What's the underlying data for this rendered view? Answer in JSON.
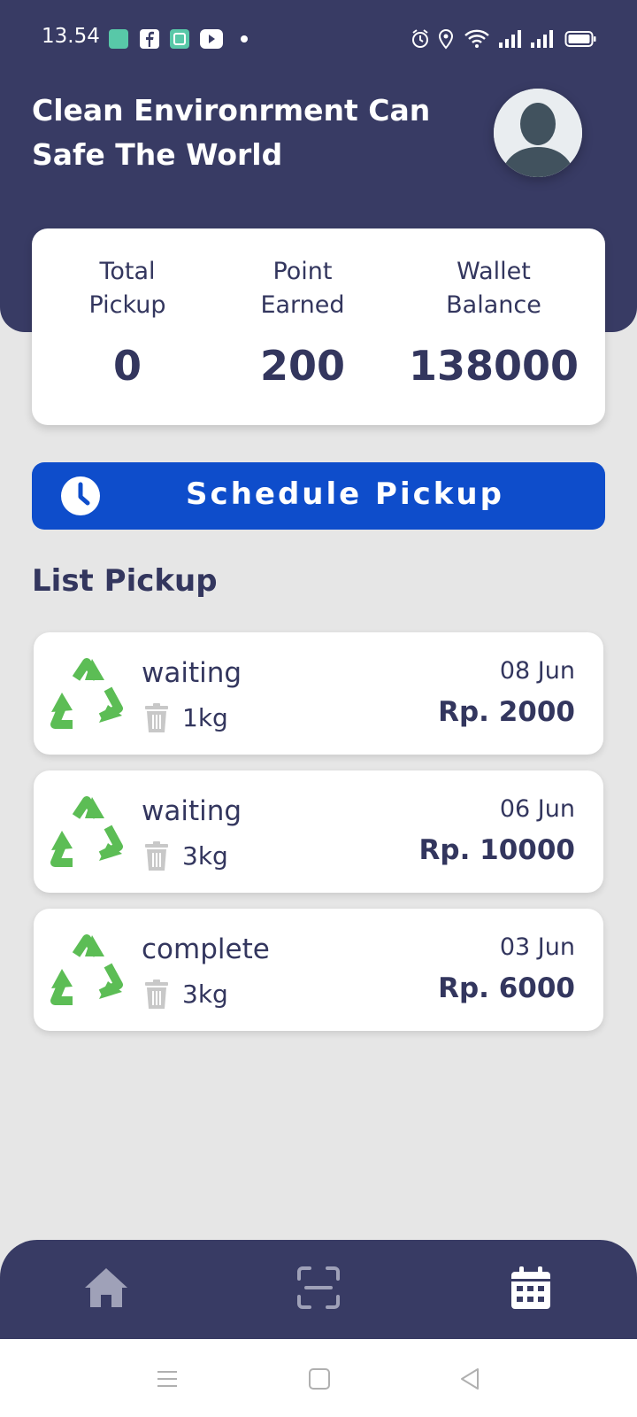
{
  "status_bar": {
    "time": "13.54",
    "left_icons": [
      "calculator-app-icon",
      "facebook-icon",
      "app-icon",
      "youtube-icon",
      "dot-icon"
    ],
    "right_icons": [
      "alarm-icon",
      "location-icon",
      "wifi-icon",
      "signal-icon",
      "signal-icon",
      "battery-icon"
    ]
  },
  "header": {
    "headline": "Clean Environrment Can Safe The World",
    "avatar_icon": "user-avatar-icon"
  },
  "stats": [
    {
      "label": "Total\nPickup",
      "value": "0"
    },
    {
      "label": "Point\nEarned",
      "value": "200"
    },
    {
      "label": "Wallet\nBalance",
      "value": "138000"
    }
  ],
  "schedule_button": {
    "label": "Schedule Pickup",
    "icon": "clock-icon"
  },
  "list": {
    "title": "List Pickup",
    "items": [
      {
        "status": "waiting",
        "weight": "1kg",
        "date": "08 Jun",
        "price": "Rp. 2000"
      },
      {
        "status": "waiting",
        "weight": "3kg",
        "date": "06 Jun",
        "price": "Rp. 10000"
      },
      {
        "status": "complete",
        "weight": "3kg",
        "date": "03 Jun",
        "price": "Rp. 6000"
      }
    ]
  },
  "bottom_nav": {
    "items": [
      "home-icon",
      "scan-icon",
      "calendar-icon"
    ],
    "active": "calendar-icon"
  },
  "colors": {
    "primary": "#383b64",
    "button": "#0e4dcb",
    "recycle": "#5cbd55",
    "background": "#e6e6e6"
  }
}
